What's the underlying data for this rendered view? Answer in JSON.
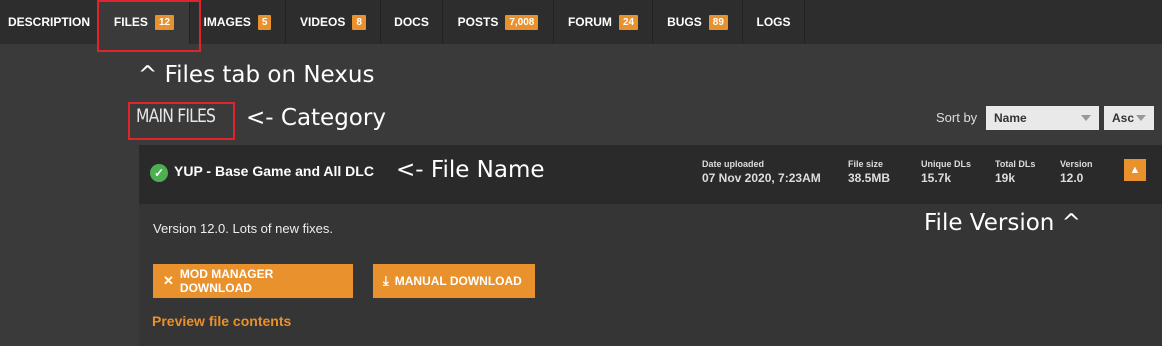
{
  "tabs": [
    {
      "label": "DESCRIPTION",
      "count": ""
    },
    {
      "label": "FILES",
      "count": "12"
    },
    {
      "label": "IMAGES",
      "count": "5"
    },
    {
      "label": "VIDEOS",
      "count": "8"
    },
    {
      "label": "DOCS",
      "count": ""
    },
    {
      "label": "POSTS",
      "count": "7,008"
    },
    {
      "label": "FORUM",
      "count": "24"
    },
    {
      "label": "BUGS",
      "count": "89"
    },
    {
      "label": "LOGS",
      "count": ""
    }
  ],
  "annotations": {
    "files_tab": "^ Files tab on Nexus",
    "category": "<- Category",
    "file_name": "<- File Name",
    "file_version": "File Version ^"
  },
  "category": "MAIN FILES",
  "sort": {
    "label": "Sort by",
    "field": "Name",
    "order": "Asc"
  },
  "file": {
    "name": "YUP - Base Game and All DLC",
    "date_uploaded_label": "Date uploaded",
    "date_uploaded": "07 Nov 2020, 7:23AM",
    "file_size_label": "File size",
    "file_size": "38.5MB",
    "unique_dls_label": "Unique DLs",
    "unique_dls": "15.7k",
    "total_dls_label": "Total DLs",
    "total_dls": "19k",
    "version_label": "Version",
    "version": "12.0",
    "description": "Version 12.0. Lots of new fixes.",
    "mod_manager_download": "MOD MANAGER DOWNLOAD",
    "manual_download": "MANUAL DOWNLOAD",
    "preview": "Preview file contents"
  },
  "colors": {
    "accent": "#e8912d",
    "highlight": "#e0242c",
    "success": "#4caf50"
  }
}
